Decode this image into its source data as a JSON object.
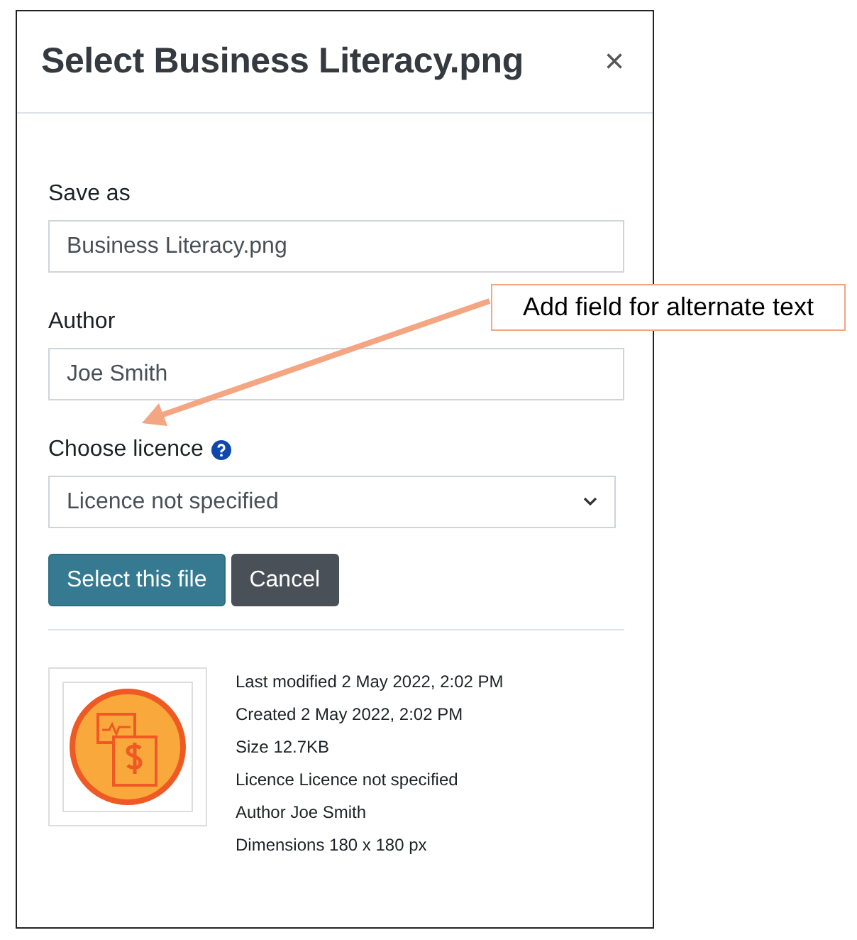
{
  "dialog": {
    "title": "Select Business Literacy.png",
    "close": "×"
  },
  "fields": [
    {
      "kind": "input",
      "label": "Save as",
      "value": "Business Literacy.png",
      "help": false
    },
    {
      "kind": "input",
      "label": "Author",
      "value": "Joe Smith",
      "help": false
    },
    {
      "kind": "select",
      "label": "Choose licence",
      "value": "Licence not specified",
      "help": true
    }
  ],
  "buttons": [
    {
      "kind": "primary",
      "label": "Select this file"
    },
    {
      "kind": "secondary",
      "label": "Cancel"
    }
  ],
  "details": [
    {
      "label": "Last modified",
      "value": "2 May 2022, 2:02 PM"
    },
    {
      "label": "Created",
      "value": "2 May 2022, 2:02 PM"
    },
    {
      "label": "Size",
      "value": "12.7KB"
    },
    {
      "label": "Licence",
      "value": "Licence not specified"
    },
    {
      "label": "Author",
      "value": "Joe Smith"
    },
    {
      "label": "Dimensions",
      "value": "180 x 180 px"
    }
  ],
  "annotation": {
    "text": "Add field for alternate text"
  }
}
